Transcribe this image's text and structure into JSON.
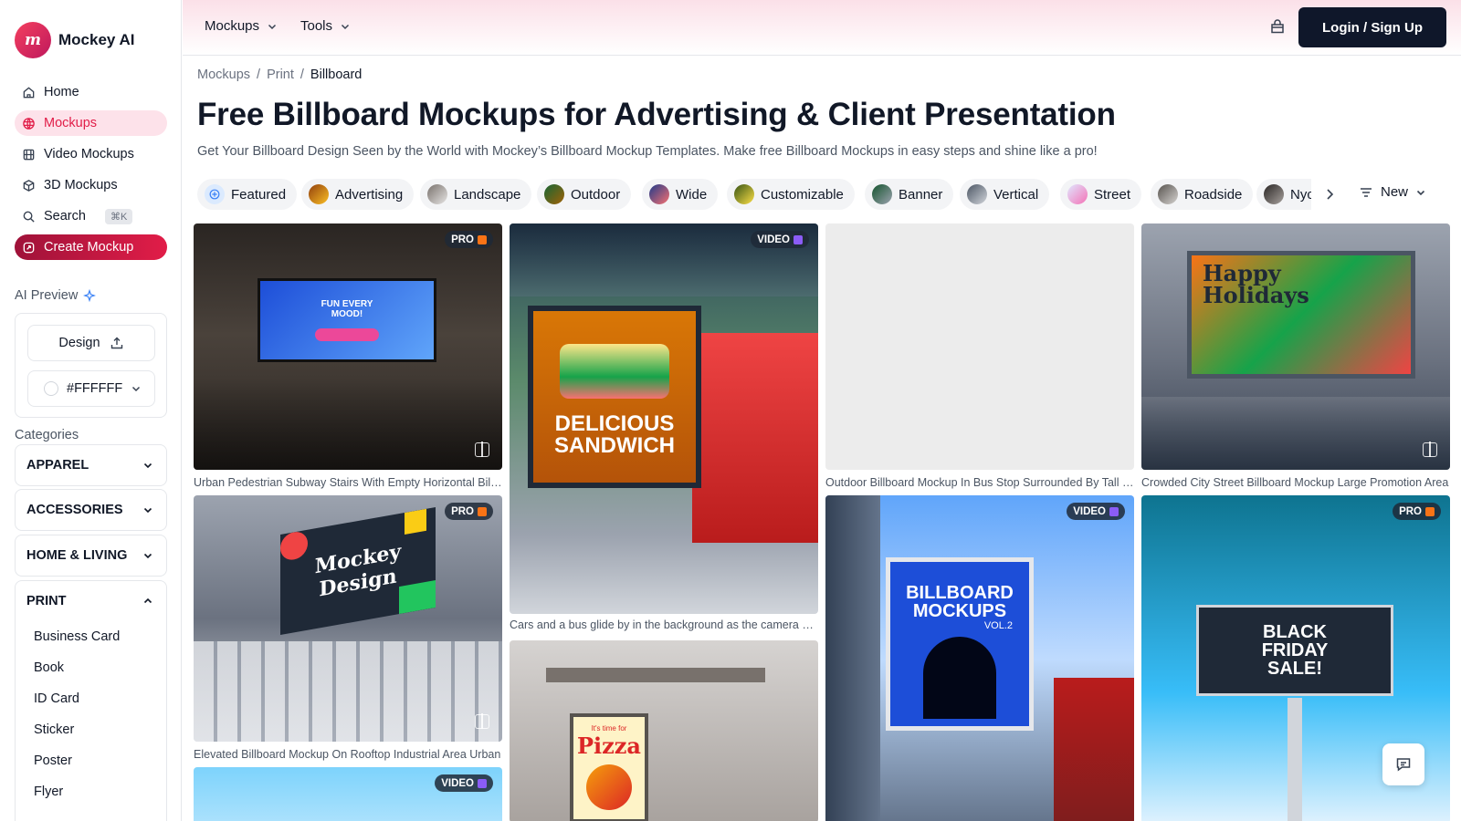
{
  "app": {
    "name": "Mockey AI",
    "logo_letters": "m"
  },
  "sidebar": {
    "nav": [
      {
        "label": "Home",
        "icon": "home-icon"
      },
      {
        "label": "Mockups",
        "icon": "globe-icon",
        "active": true
      },
      {
        "label": "Video Mockups",
        "icon": "film-icon"
      },
      {
        "label": "3D Mockups",
        "icon": "cube-icon"
      },
      {
        "label": "Search",
        "icon": "search-icon",
        "shortcut": "⌘K"
      },
      {
        "label": "Create Mockup",
        "icon": "create-icon"
      }
    ],
    "ai_preview": {
      "label": "AI Preview",
      "design_button": "Design",
      "color_value": "#FFFFFF"
    },
    "categories_heading": "Categories",
    "categories": [
      {
        "label": "APPAREL",
        "expanded": false
      },
      {
        "label": "ACCESSORIES",
        "expanded": false
      },
      {
        "label": "HOME & LIVING",
        "expanded": false
      },
      {
        "label": "PRINT",
        "expanded": true,
        "items": [
          "Business Card",
          "Book",
          "ID Card",
          "Sticker",
          "Poster",
          "Flyer"
        ]
      }
    ]
  },
  "topbar": {
    "menus": [
      "Mockups",
      "Tools"
    ],
    "login_label": "Login / Sign Up"
  },
  "breadcrumb": [
    "Mockups",
    "Print",
    "Billboard"
  ],
  "page": {
    "title": "Free Billboard Mockups for Advertising & Client Presentation",
    "subtitle": "Get Your Billboard Design Seen by the World with Mockey’s Billboard Mockup Templates. Make free Billboard Mockups in easy steps and shine like a pro!"
  },
  "filters": {
    "chips": [
      "Featured",
      "Advertising",
      "Landscape",
      "Outdoor",
      "Wide",
      "Customizable",
      "Banner",
      "Vertical",
      "Street",
      "Roadside",
      "Nyc"
    ],
    "sort_label": "New"
  },
  "cards": [
    {
      "badge": "PRO",
      "caption": "Urban Pedestrian Subway Stairs With Empty Horizontal Billboard",
      "art": [
        "FUN EVERY",
        "MOOD!"
      ]
    },
    {
      "badge": "VIDEO",
      "caption": "Cars and a bus glide by in the background as the camera moves",
      "art": [
        "DELICIOUS",
        "SANDWICH"
      ]
    },
    {
      "badge": "",
      "caption": "Outdoor Billboard Mockup In Bus Stop Surrounded By Tall Buildings",
      "art": []
    },
    {
      "badge": "",
      "caption": "Crowded City Street Billboard Mockup Large Promotion Area",
      "art": [
        "Happy",
        "Holidays"
      ]
    },
    {
      "badge": "PRO",
      "caption": "Elevated Billboard Mockup On Rooftop Industrial Area Urban",
      "art": [
        "Mockey",
        "Design"
      ]
    },
    {
      "badge": "",
      "caption": "",
      "art": [
        "Pizza",
        "It's time for"
      ]
    },
    {
      "badge": "VIDEO",
      "caption": "",
      "art": [
        "BILLBOARD",
        "MOCKUPS",
        "VOL.2"
      ]
    },
    {
      "badge": "PRO",
      "caption": "",
      "art": [
        "BLACK",
        "FRIDAY",
        "SALE!"
      ]
    },
    {
      "badge": "VIDEO",
      "caption": "",
      "art": []
    }
  ],
  "colors": {
    "accent": "#e11d48",
    "pro_badge": "#f97316",
    "video_badge": "#8b5cf6",
    "login_bg": "#0f172a"
  }
}
